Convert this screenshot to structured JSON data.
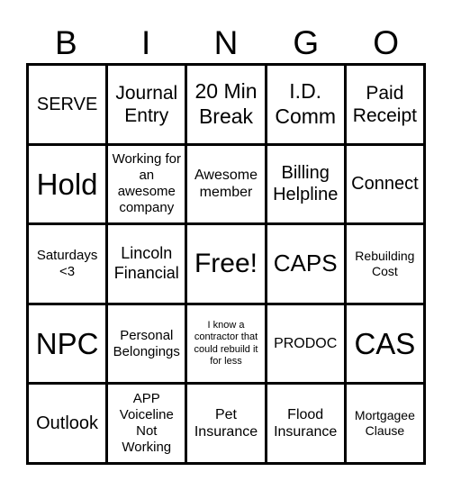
{
  "header": [
    "B",
    "I",
    "N",
    "G",
    "O"
  ],
  "cells": [
    "SERVE",
    "Journal Entry",
    "20 Min Break",
    "I.D. Comm",
    "Paid Receipt",
    "Hold",
    "Working for an awesome company",
    "Awesome member",
    "Billing Helpline",
    "Connect",
    "Saturdays <3",
    "Lincoln Financial",
    "Free!",
    "CAPS",
    "Rebuilding Cost",
    "NPC",
    "Personal Belongings",
    "I know a contractor that could rebuild it for less",
    "PRODOC",
    "CAS",
    "Outlook",
    "APP Voiceline Not Working",
    "Pet Insurance",
    "Flood Insurance",
    "Mortgagee Clause"
  ]
}
